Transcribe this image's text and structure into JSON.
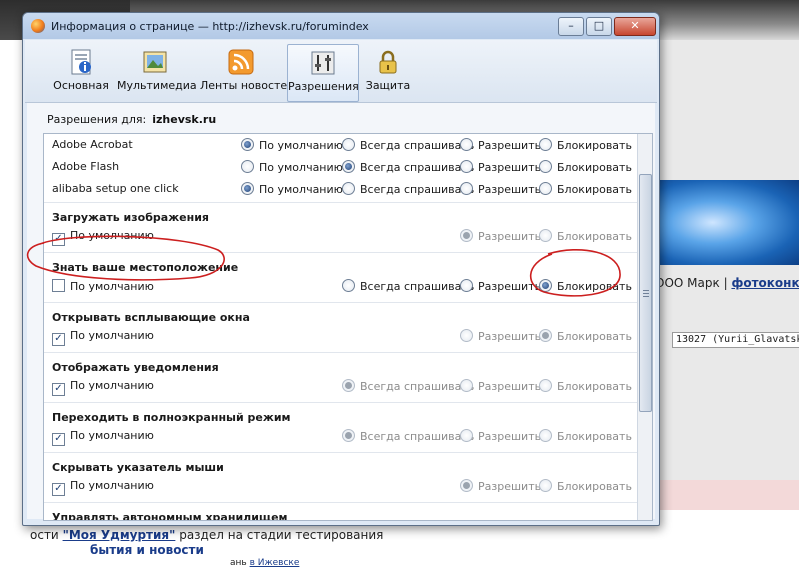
{
  "background_page": {
    "links_text": "ООО Марк",
    "links_sep": "|",
    "links_bold": "фотоконку",
    "field_value": "13027 (Yurii_Glavatskih",
    "line1_prefix": "ости",
    "line1_link": "\"Моя Удмуртия\"",
    "line1_suffix": "раздел на стадии тестирования",
    "line2": "бытия и новости",
    "line3_prefix": "ань",
    "line3_link": "в Ижевске"
  },
  "window": {
    "title": "Информация о странице — http://izhevsk.ru/forumindex",
    "minimize": "–",
    "maximize": "□",
    "close": "✕"
  },
  "toolbar": {
    "tabs": [
      {
        "label": "Основная",
        "icon": "info-page-icon"
      },
      {
        "label": "Мультимедиа",
        "icon": "media-icon"
      },
      {
        "label": "Ленты новостей",
        "icon": "rss-icon"
      },
      {
        "label": "Разрешения",
        "icon": "permissions-icon",
        "active": true
      },
      {
        "label": "Защита",
        "icon": "lock-icon"
      }
    ]
  },
  "permissions": {
    "for_label": "Разрешения для:",
    "site": "izhevsk.ru",
    "plugins": [
      {
        "name": "Adobe Acrobat",
        "options": [
          "По умолчанию",
          "Всегда спрашивать",
          "Разрешить",
          "Блокировать"
        ],
        "selected": 0
      },
      {
        "name": "Adobe Flash",
        "options": [
          "По умолчанию",
          "Всегда спрашивать",
          "Разрешить",
          "Блокировать"
        ],
        "selected": 1
      },
      {
        "name": "alibaba setup one click",
        "options": [
          "По умолчанию",
          "Всегда спрашивать",
          "Разрешить",
          "Блокировать"
        ],
        "selected": 0
      }
    ],
    "sections": [
      {
        "title": "Загружать изображения",
        "default_label": "По умолчанию",
        "default_checked": true,
        "opt_allow": "Разрешить",
        "opt_block": "Блокировать"
      },
      {
        "title": "Знать ваше местоположение",
        "default_label": "По умолчанию",
        "default_checked": false,
        "opt_ask": "Всегда спрашивать",
        "opt_allow": "Разрешить",
        "opt_block": "Блокировать"
      },
      {
        "title": "Открывать всплывающие окна",
        "default_label": "По умолчанию",
        "default_checked": true,
        "opt_allow": "Разрешить",
        "opt_block": "Блокировать"
      },
      {
        "title": "Отображать уведомления",
        "default_label": "По умолчанию",
        "default_checked": true,
        "opt_ask": "Всегда спрашивать",
        "opt_allow": "Разрешить",
        "opt_block": "Блокировать"
      },
      {
        "title": "Переходить в полноэкранный режим",
        "default_label": "По умолчанию",
        "default_checked": true,
        "opt_ask": "Всегда спрашивать",
        "opt_allow": "Разрешить",
        "opt_block": "Блокировать"
      },
      {
        "title": "Скрывать указатель мыши",
        "default_label": "По умолчанию",
        "default_checked": true,
        "opt_allow": "Разрешить",
        "opt_block": "Блокировать"
      },
      {
        "title": "Управлять автономным хранилищем"
      }
    ]
  },
  "annotation_color": "#cc1f1f"
}
